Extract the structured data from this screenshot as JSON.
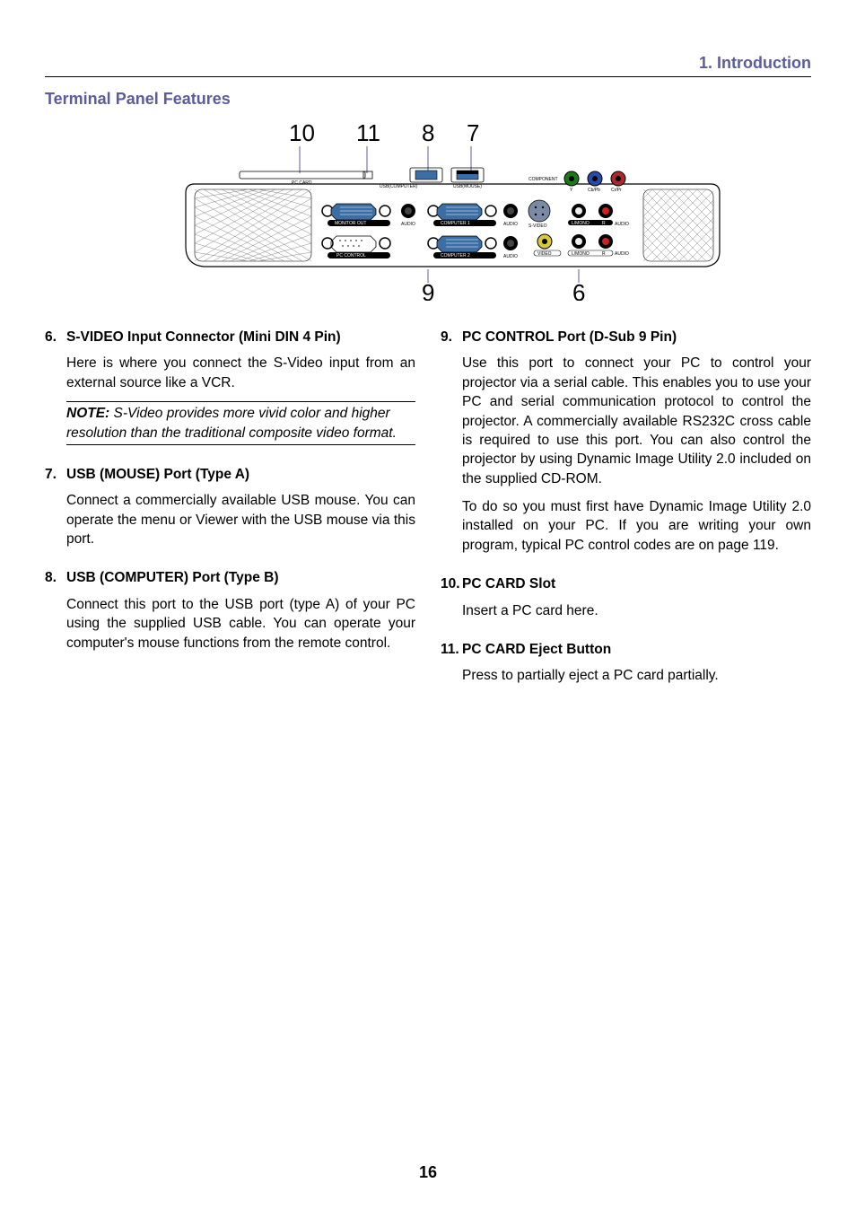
{
  "header": {
    "chapter": "1. Introduction"
  },
  "section_title": "Terminal Panel Features",
  "diagram": {
    "callouts": {
      "c10": "10",
      "c11": "11",
      "c8": "8",
      "c7": "7",
      "c9": "9",
      "c6": "6"
    },
    "labels": {
      "pc_card": "PC CARD",
      "usb_computer": "USB(COMPUTER)",
      "usb_mouse": "USB(MOUSE)",
      "monitor_out": "MONITOR OUT",
      "audio": "AUDIO",
      "pc_control": "PC CONTROL",
      "computer1": "COMPUTER 1",
      "computer2": "COMPUTER 2",
      "component": "COMPONENT",
      "y": "Y",
      "cbpb": "Cb/Pb",
      "crpr": "Cr/Pr",
      "svideo": "S-VIDEO",
      "lmono": "L/MONO",
      "r": "R",
      "video": "VIDEO"
    }
  },
  "left_items": [
    {
      "num": "6.",
      "title": "S-VIDEO Input Connector (Mini DIN 4 Pin)",
      "paras": [
        "Here is where you connect the S-Video input from an external source like a VCR."
      ],
      "note": {
        "label": "NOTE:",
        "text": " S-Video provides more vivid color and higher resolution than the traditional composite video format."
      }
    },
    {
      "num": "7.",
      "title": "USB (MOUSE) Port (Type A)",
      "paras": [
        "Connect a commercially available USB mouse. You can operate the menu or Viewer with the USB mouse via this port."
      ]
    },
    {
      "num": "8.",
      "title": "USB (COMPUTER) Port (Type B)",
      "paras": [
        "Connect this port to the USB port (type A) of your PC using the supplied USB cable. You can operate your computer's mouse functions from the remote control."
      ]
    }
  ],
  "right_items": [
    {
      "num": "9.",
      "title": "PC CONTROL Port (D-Sub 9 Pin)",
      "paras": [
        "Use this port to connect your PC to control your projector via a serial cable. This enables you to use your PC and serial communication protocol to control the projector. A commercially available RS232C cross cable is required to use this port. You can also control the projector by using Dynamic Image Utility 2.0 included on the supplied CD-ROM.",
        "To do so you must first have Dynamic Image Utility 2.0 installed on your PC. If you are writing your own program, typical PC control codes are on page 119."
      ]
    },
    {
      "num": "10.",
      "title": "PC CARD Slot",
      "paras": [
        "Insert a PC card here."
      ]
    },
    {
      "num": "11.",
      "title": "PC CARD Eject Button",
      "paras": [
        "Press to partially eject a PC card partially."
      ]
    }
  ],
  "page_number": "16"
}
